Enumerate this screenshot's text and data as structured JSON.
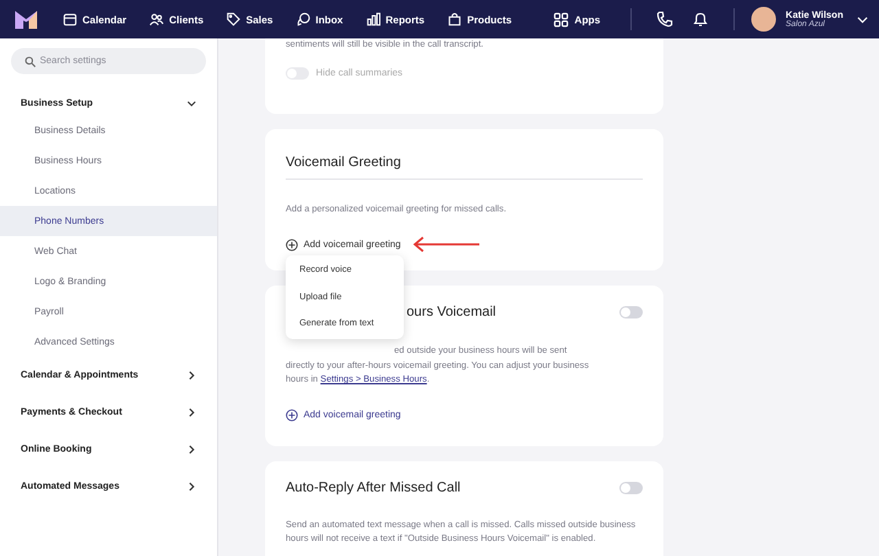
{
  "nav": {
    "items": [
      {
        "label": "Calendar"
      },
      {
        "label": "Clients"
      },
      {
        "label": "Sales"
      },
      {
        "label": "Inbox"
      },
      {
        "label": "Reports"
      },
      {
        "label": "Products"
      }
    ],
    "apps": "Apps",
    "user": {
      "name": "Katie Wilson",
      "business": "Salon Azul"
    }
  },
  "sidebar": {
    "search": {
      "placeholder": "Search settings"
    },
    "sections": [
      {
        "label": "Business Setup",
        "expanded": true,
        "children": [
          {
            "label": "Business Details",
            "selected": false
          },
          {
            "label": "Business Hours",
            "selected": false
          },
          {
            "label": "Locations",
            "selected": false
          },
          {
            "label": "Phone Numbers",
            "selected": true
          },
          {
            "label": "Web Chat",
            "selected": false
          },
          {
            "label": "Logo & Branding",
            "selected": false
          },
          {
            "label": "Payroll",
            "selected": false
          },
          {
            "label": "Advanced Settings",
            "selected": false
          }
        ]
      },
      {
        "label": "Calendar & Appointments",
        "expanded": false
      },
      {
        "label": "Payments & Checkout",
        "expanded": false
      },
      {
        "label": "Online Booking",
        "expanded": false
      },
      {
        "label": "Automated Messages",
        "expanded": false
      }
    ]
  },
  "top_card": {
    "text": "sentiments will still be visible in the call transcript.",
    "toggle": {
      "label": "Hide call summaries",
      "on": false,
      "disabled": true
    }
  },
  "voicemail_card": {
    "title": "Voicemail Greeting",
    "description": "Add a personalized voicemail greeting for missed calls.",
    "add_button": "Add voicemail greeting",
    "menu": [
      "Record voice",
      "Upload file",
      "Generate from text"
    ]
  },
  "after_hours_card": {
    "title": "ours Voicemail",
    "toggle_on": false,
    "description": "ed outside your business hours will be sent\ndirectly to your after-hours voicemail greeting. You can adjust your business\nhours in ",
    "link": "Settings > Business Hours",
    "link_after": ".",
    "add_button": "Add voicemail greeting"
  },
  "auto_reply_card": {
    "title": "Auto-Reply After Missed Call",
    "toggle_on": false,
    "description": "Send an automated text message when a call is missed. Calls missed outside business hours will not receive a text if \"Outside Business Hours Voicemail\" is enabled."
  }
}
